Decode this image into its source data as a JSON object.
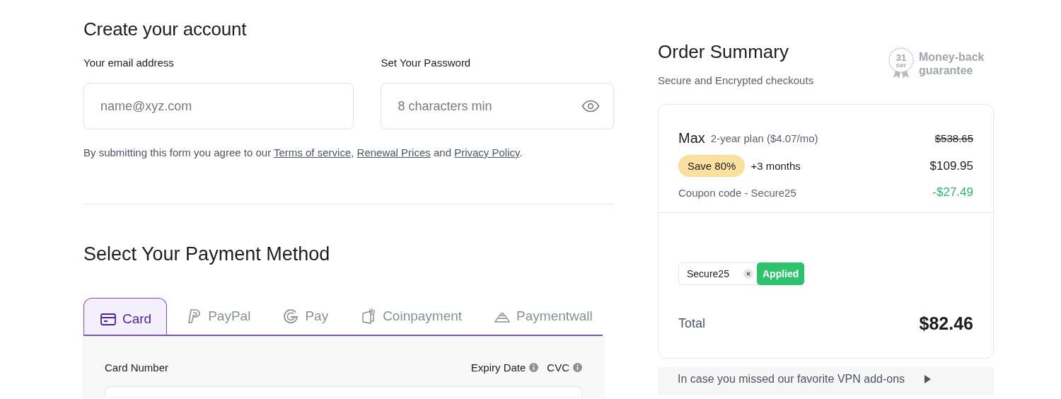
{
  "account": {
    "title": "Create your account",
    "fields": [
      {
        "kind": "email",
        "label": "Your email address",
        "placeholder": "name@xyz.com"
      },
      {
        "kind": "password",
        "label": "Set Your Password",
        "placeholder": "8 characters min"
      }
    ],
    "agreement": [
      {
        "kind": "text",
        "text": "By submitting this form you agree to our "
      },
      {
        "kind": "link",
        "text": "Terms of service"
      },
      {
        "kind": "text",
        "text": ", "
      },
      {
        "kind": "link",
        "text": "Renewal Prices"
      },
      {
        "kind": "text",
        "text": " and "
      },
      {
        "kind": "link",
        "text": "Privacy Policy"
      },
      {
        "kind": "text",
        "text": "."
      }
    ]
  },
  "payment": {
    "title": "Select Your Payment Method",
    "tabs": [
      {
        "label": "Card",
        "kind": "card",
        "selected": true
      },
      {
        "label": "PayPal",
        "kind": "paypal",
        "selected": false
      },
      {
        "label": "Pay",
        "kind": "gpay",
        "selected": false
      },
      {
        "label": "Coinpayment",
        "kind": "coin",
        "selected": false
      },
      {
        "label": "Paymentwall",
        "kind": "wall",
        "selected": false
      }
    ],
    "labels": [
      {
        "text": "Card Number",
        "info": false
      },
      {
        "text": "Expiry Date",
        "info": true
      },
      {
        "text": "CVC",
        "info": true
      }
    ]
  },
  "summary": {
    "title": "Order Summary",
    "subtitle": "Secure and Encrypted checkouts",
    "badge": {
      "number": "31",
      "unit": "DAY",
      "text": "Money-back guarantee"
    },
    "plan": {
      "name": "Max",
      "description": "2-year plan ($4.07/mo)",
      "old_price": "$538.65"
    },
    "save": {
      "badge": "Save 80%",
      "bonus": "+3 months",
      "price": "$109.95"
    },
    "coupon": {
      "label": "Coupon code - Secure25",
      "discount": "-$27.49",
      "value": "Secure25",
      "status": "Applied"
    },
    "total": {
      "label": "Total",
      "value": "$82.46"
    },
    "addons": "In case you missed our favorite VPN add-ons"
  }
}
